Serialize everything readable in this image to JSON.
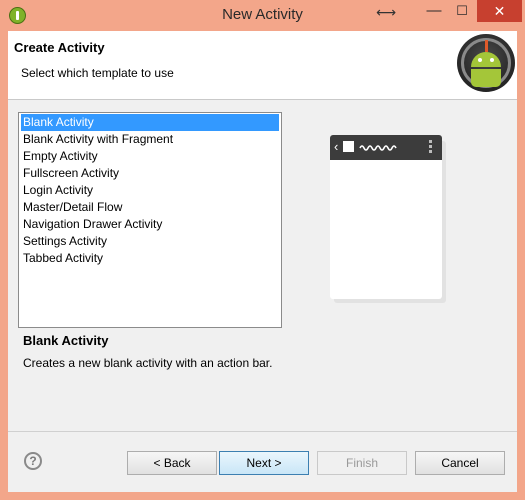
{
  "window": {
    "title": "New Activity",
    "controls": {
      "minimize": "—",
      "maximize": "☐",
      "close": "✕"
    },
    "resize_hint": "⟷"
  },
  "header": {
    "title": "Create Activity",
    "subtitle": "Select which template to use"
  },
  "templates": {
    "items": [
      {
        "label": "Blank Activity",
        "selected": true
      },
      {
        "label": "Blank Activity with Fragment",
        "selected": false
      },
      {
        "label": "Empty Activity",
        "selected": false
      },
      {
        "label": "Fullscreen Activity",
        "selected": false
      },
      {
        "label": "Login Activity",
        "selected": false
      },
      {
        "label": "Master/Detail Flow",
        "selected": false
      },
      {
        "label": "Navigation Drawer Activity",
        "selected": false
      },
      {
        "label": "Settings Activity",
        "selected": false
      },
      {
        "label": "Tabbed Activity",
        "selected": false
      }
    ]
  },
  "preview": {
    "chevron": "‹"
  },
  "description": {
    "title": "Blank Activity",
    "text": "Creates a new blank activity with an action bar."
  },
  "footer": {
    "help": "?",
    "back_label": "< Back",
    "next_label": "Next >",
    "finish_label": "Finish",
    "cancel_label": "Cancel"
  },
  "colors": {
    "titlebar": "#f3a68a",
    "selection": "#3399ff",
    "close_button": "#c7402f",
    "android_green": "#a4c639"
  }
}
